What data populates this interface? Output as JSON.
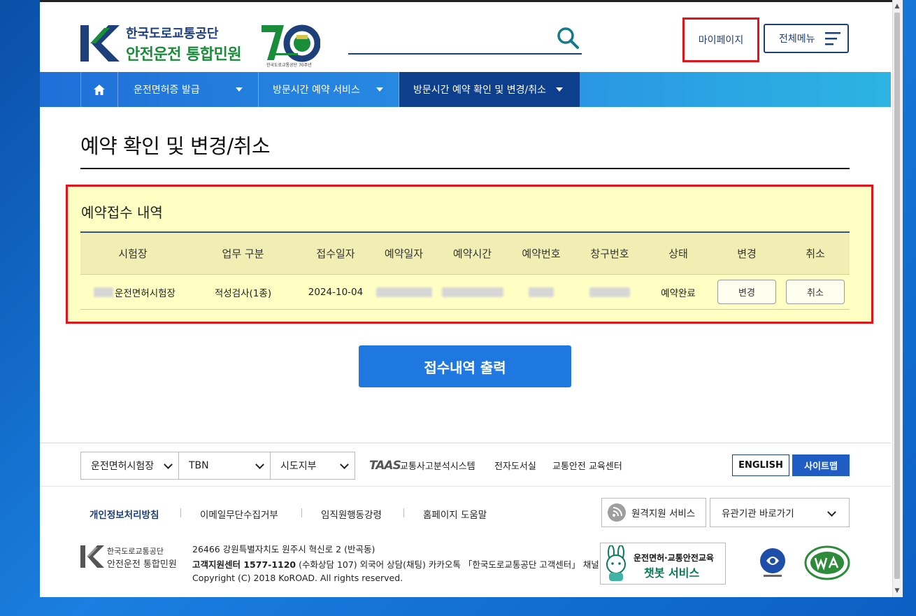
{
  "header": {
    "logo_line1": "한국도로교통공단",
    "logo_line2": "안전운전 통합민원",
    "anniversary_caption": "한국도로교통공단 70주년",
    "mypage_label": "마이페이지",
    "allmenu_label": "전체메뉴"
  },
  "nav": {
    "items": [
      {
        "label": "운전면허증 발급"
      },
      {
        "label": "방문시간 예약 서비스"
      },
      {
        "label": "방문시간 예약 확인 및 변경/취소"
      }
    ]
  },
  "page": {
    "title": "예약 확인 및 변경/취소"
  },
  "reservation": {
    "section_title": "예약접수 내역",
    "columns": [
      "시험장",
      "업무 구분",
      "접수일자",
      "예약일자",
      "예약시간",
      "예약번호",
      "창구번호",
      "상태",
      "변경",
      "취소"
    ],
    "row": {
      "site": "운전면허시험장",
      "task": "적성검사(1종)",
      "received_date": "2024-10-04",
      "status": "예약완료",
      "change_label": "변경",
      "cancel_label": "취소"
    },
    "print_label": "접수내역 출력"
  },
  "footer": {
    "select1": "운전면허시험장",
    "select2": "TBN",
    "select3": "시도지부",
    "taas_logo": "TAAS",
    "links": [
      "교통사고분석시스템",
      "전자도서실",
      "교통안전 교육센터"
    ],
    "english_label": "ENGLISH",
    "sitemap_label": "사이트맵",
    "policy_links": [
      "개인정보처리방침",
      "이메일무단수집거부",
      "임직원행동강령",
      "홈페이지 도움말"
    ],
    "remote_label": "원격지원 서비스",
    "related_label": "유관기관 바로가기",
    "logo_line1": "한국도로교통공단",
    "logo_line2": "안전운전 통합민원",
    "address": "26466 강원특별자치도 원주시 혁신로 2 (반곡동)",
    "callcenter_bold": "고객지원센터 1577-1120",
    "callcenter_rest": " (수화상담 107) 외국어 상담(채팅) 카카오톡 「한국도로교통공단 고객센터」 채널",
    "copyright": "Copyright (C) 2018 KoROAD. All rights reserved.",
    "chatbot_line1": "운전면허·교통안전교육",
    "chatbot_line2": "챗봇 서비스"
  },
  "colors": {
    "brand_navy": "#1d3f7a",
    "brand_green": "#1a8d3a",
    "nav_active": "#0e3f8c",
    "highlight_red": "#e0141a",
    "highlight_yellow": "#ffffc4",
    "primary_button": "#1f78e0"
  }
}
